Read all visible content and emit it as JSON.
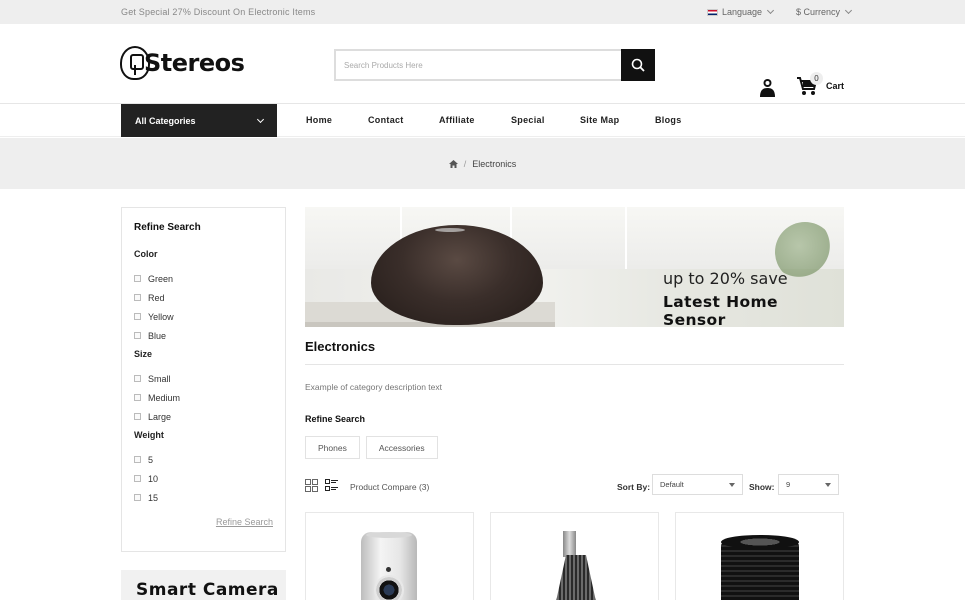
{
  "topbar": {
    "promo": "Get Special 27% Discount On Electronic Items",
    "language": "Language",
    "currency": "$ Currency"
  },
  "header": {
    "logo_text": "Stereos",
    "search_placeholder": "Search Products Here",
    "cart_label": "Cart",
    "cart_count": "0"
  },
  "nav": {
    "all_categories": "All Categories",
    "items": [
      "Home",
      "Contact",
      "Affiliate",
      "Special",
      "Site Map",
      "Blogs"
    ]
  },
  "breadcrumb": {
    "current": "Electronics"
  },
  "sidebar": {
    "title": "Refine Search",
    "groups": [
      {
        "name": "Color",
        "options": [
          "Green",
          "Red",
          "Yellow",
          "Blue"
        ]
      },
      {
        "name": "Size",
        "options": [
          "Small",
          "Medium",
          "Large"
        ]
      },
      {
        "name": "Weight",
        "options": [
          "5",
          "10",
          "15"
        ]
      }
    ],
    "refine_link": "Refine Search",
    "promo_title": "Smart Camera"
  },
  "banner": {
    "subtitle": "up to 20% save",
    "title": "Latest Home Sensor"
  },
  "category": {
    "title": "Electronics",
    "description": "Example of category description text",
    "refine_heading": "Refine Search",
    "subcategories": [
      "Phones",
      "Accessories"
    ]
  },
  "toolbar": {
    "compare": "Product Compare (3)",
    "sort_label": "Sort By:",
    "sort_value": "Default",
    "show_label": "Show:",
    "show_value": "9"
  },
  "products": [
    "security-camera",
    "speaker",
    "camera-lens"
  ]
}
